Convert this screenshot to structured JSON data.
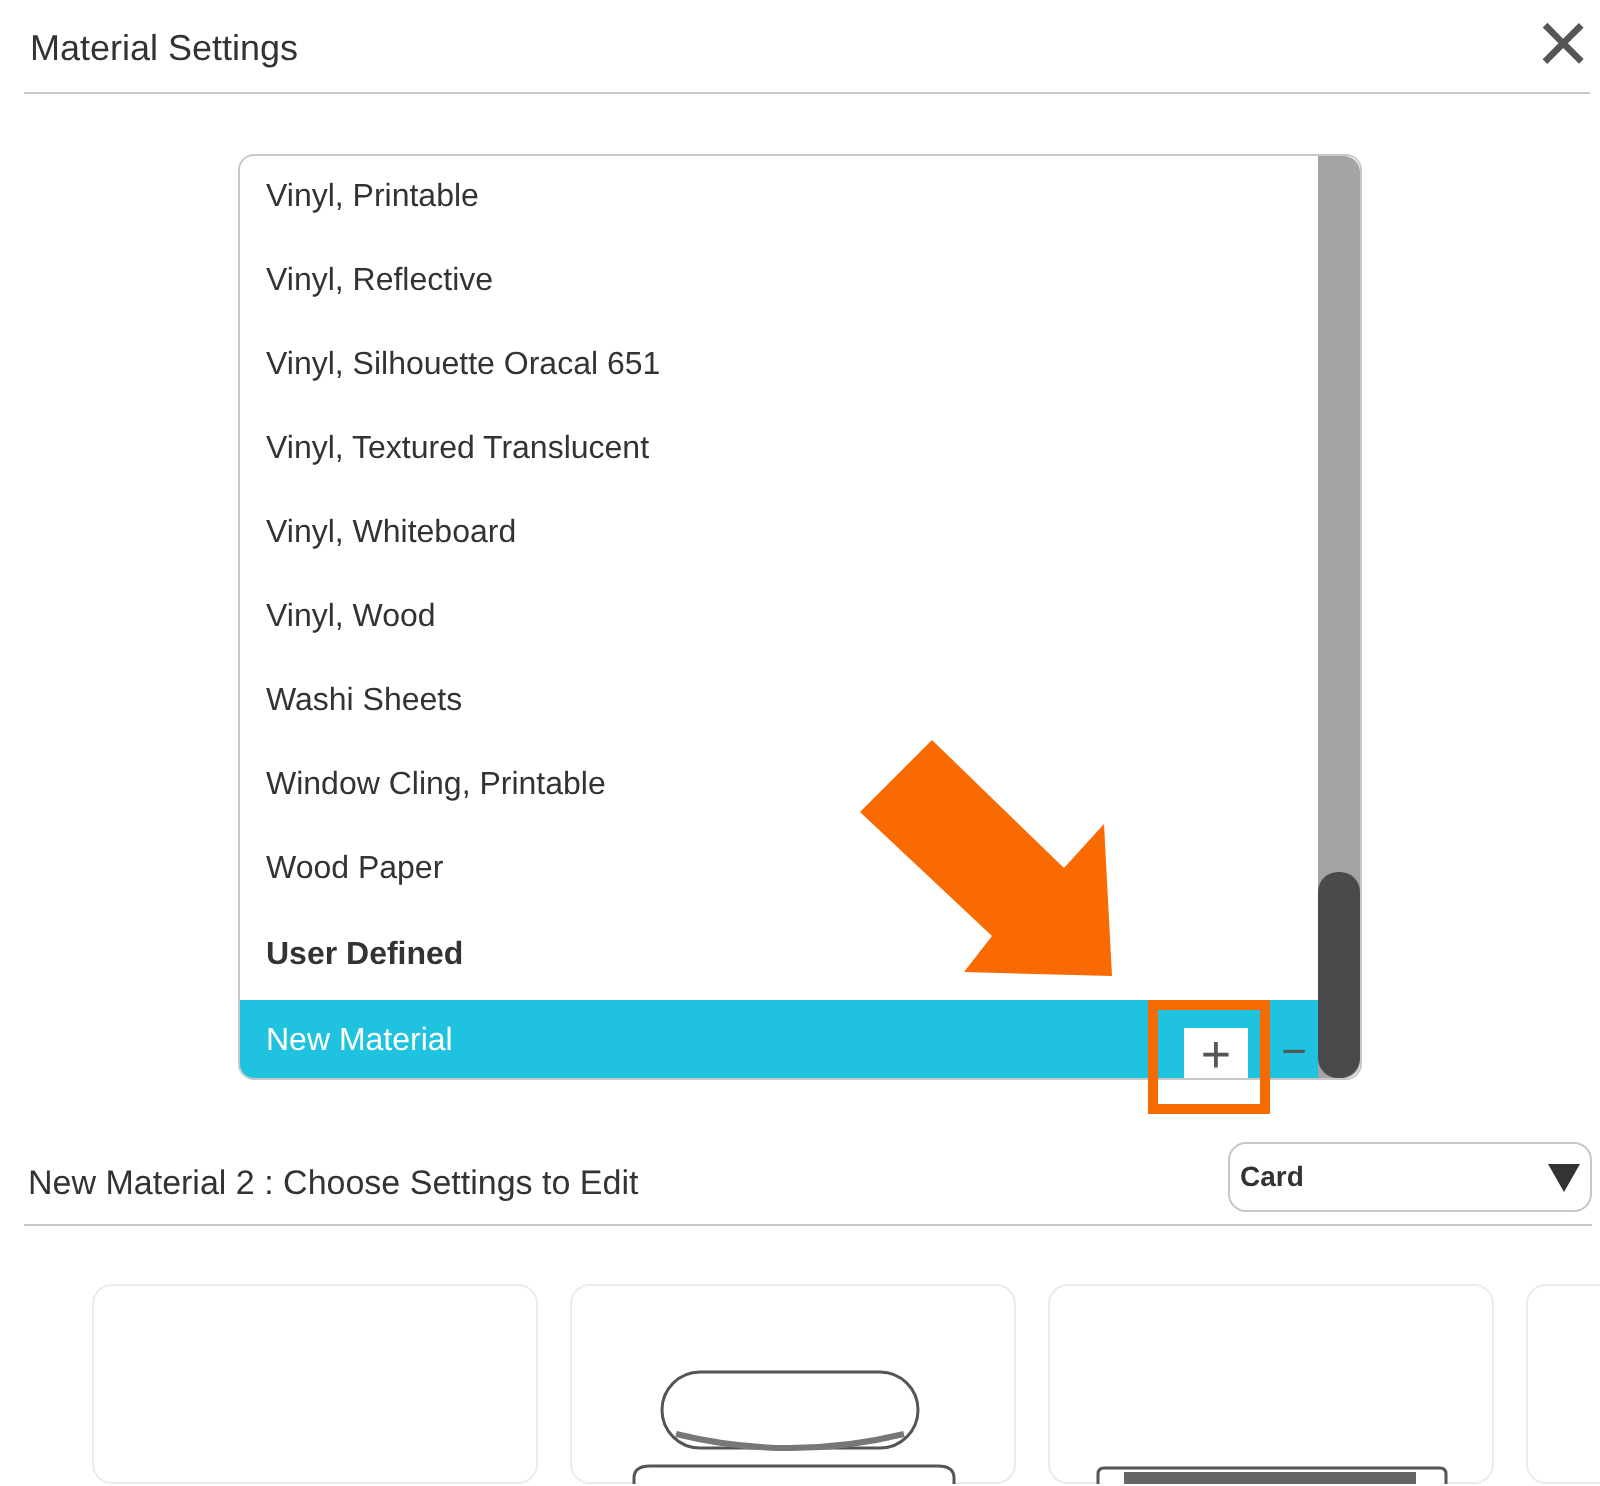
{
  "window": {
    "title": "Material Settings",
    "close": "×"
  },
  "materials": [
    {
      "kind": "item",
      "label": "Vinyl, Printable",
      "selected": false
    },
    {
      "kind": "item",
      "label": "Vinyl, Reflective",
      "selected": false
    },
    {
      "kind": "item",
      "label": "Vinyl, Silhouette Oracal 651",
      "selected": false
    },
    {
      "kind": "item",
      "label": "Vinyl, Textured Translucent",
      "selected": false
    },
    {
      "kind": "item",
      "label": "Vinyl, Whiteboard",
      "selected": false
    },
    {
      "kind": "item",
      "label": "Vinyl, Wood",
      "selected": false
    },
    {
      "kind": "item",
      "label": "Washi Sheets",
      "selected": false
    },
    {
      "kind": "item",
      "label": "Window Cling, Printable",
      "selected": false
    },
    {
      "kind": "item",
      "label": "Wood Paper",
      "selected": false
    },
    {
      "kind": "header",
      "label": "User Defined",
      "selected": false
    },
    {
      "kind": "item",
      "label": "New Material",
      "selected": true
    }
  ],
  "list_buttons": {
    "add": "+",
    "remove": "−"
  },
  "section": {
    "title": "New Material 2 : Choose Settings to Edit",
    "dropdown": "Card"
  },
  "cards": [
    {
      "kind": "blank"
    },
    {
      "kind": "blade"
    },
    {
      "kind": "machine"
    },
    {
      "kind": "partial"
    }
  ]
}
